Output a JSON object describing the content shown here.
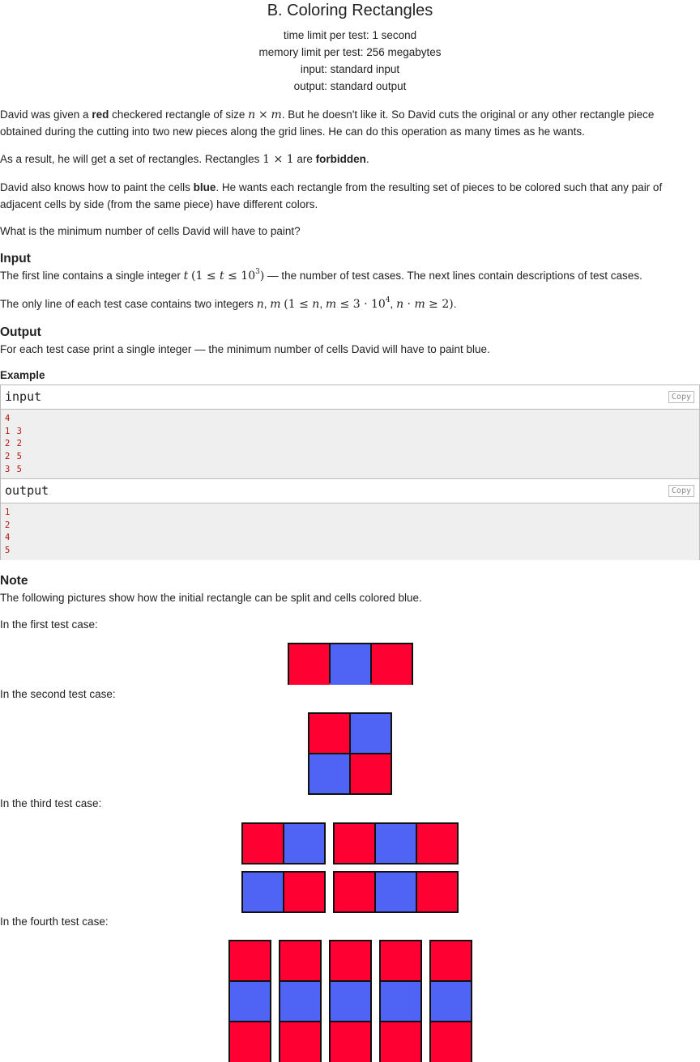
{
  "problem": {
    "title": "B. Coloring Rectangles",
    "time_limit": "time limit per test: 1 second",
    "memory_limit": "memory limit per test: 256 megabytes",
    "input_file": "input: standard input",
    "output_file": "output: standard output"
  },
  "statement": {
    "p1_a": "David was given a ",
    "p1_red": "red",
    "p1_b": " checkered rectangle of size ",
    "p1_c": ". But he doesn't like it. So David cuts the original or any other rectangle piece obtained during the cutting into two new pieces along the grid lines. He can do this operation as many times as he wants.",
    "p2_a": "As a result, he will get a set of rectangles. Rectangles ",
    "p2_b": " are ",
    "p2_forbidden": "forbidden",
    "p2_c": ".",
    "p3_a": "David also knows how to paint the cells ",
    "p3_blue": "blue",
    "p3_b": ". He wants each rectangle from the resulting set of pieces to be colored such that any pair of adjacent cells by side (from the same piece) have different colors.",
    "p4": "What is the minimum number of cells David will have to paint?"
  },
  "input_section": {
    "heading": "Input",
    "l1_a": "The first line contains a single integer ",
    "l1_b": " — the number of test cases. The next lines contain descriptions of test cases.",
    "l2_a": "The only line of each test case contains two integers ",
    "l2_b": "."
  },
  "output_section": {
    "heading": "Output",
    "text": "For each test case print a single integer — the minimum number of cells David will have to paint blue."
  },
  "example": {
    "heading": "Example",
    "input_label": "input",
    "output_label": "output",
    "copy_label": "Copy",
    "input_lines": [
      "4",
      "1 3",
      "2 2",
      "2 5",
      "3 5"
    ],
    "output_lines": [
      "1",
      "2",
      "4",
      "5"
    ]
  },
  "note": {
    "heading": "Note",
    "intro": "The following pictures show how the initial rectangle can be split and cells colored blue.",
    "case1": "In the first test case:",
    "case2": "In the second test case:",
    "case3": "In the third test case:",
    "case4": "In the fourth test case:"
  },
  "colors": {
    "red": "#ff0033",
    "blue": "#4f64f4"
  }
}
